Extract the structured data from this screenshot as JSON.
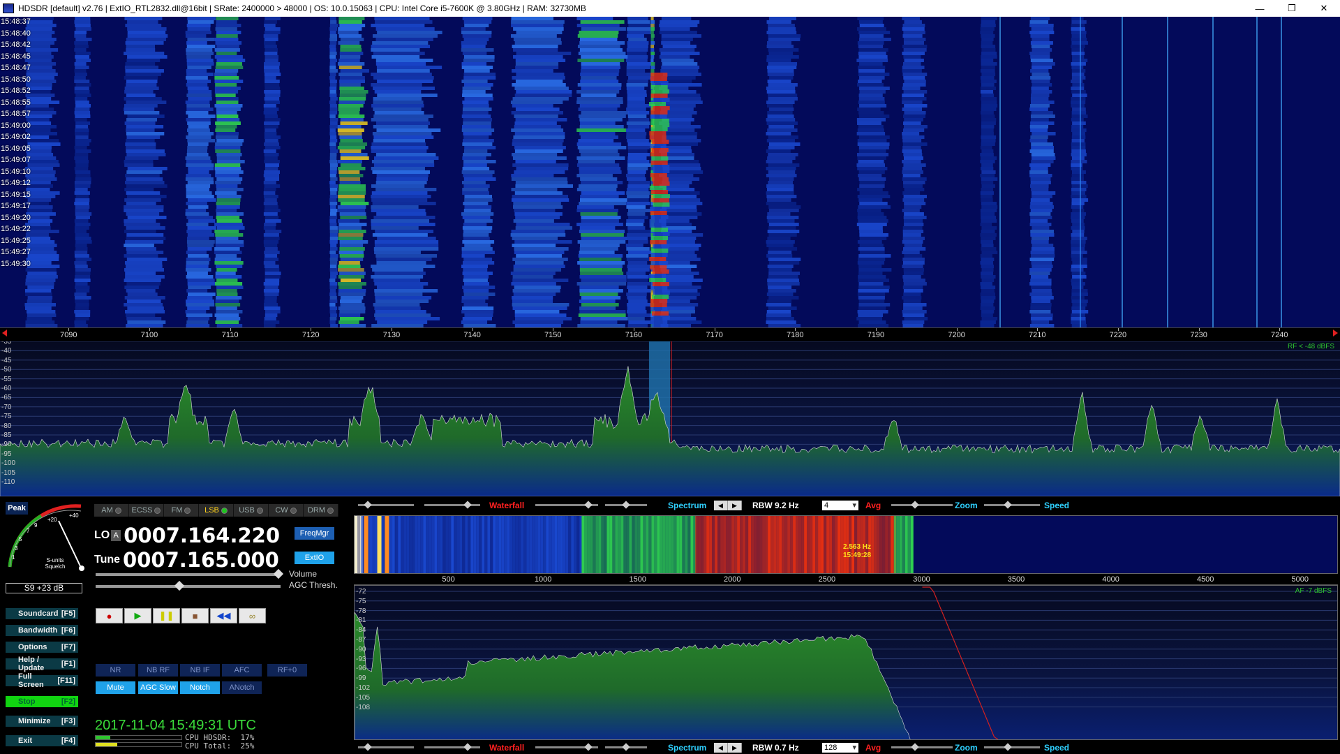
{
  "window": {
    "title": "HDSDR  [default]  v2.76   |  ExtIO_RTL2832.dll@16bit  |  SRate: 2400000 > 48000  |  OS: 10.0.15063   |  CPU: Intel Core i5-7600K @ 3.80GHz  |  RAM: 32730MB",
    "minimize_glyph": "—",
    "restore_glyph": "❐",
    "close_glyph": "✕"
  },
  "waterfall": {
    "times": [
      "15:48:37",
      "15:48:40",
      "15:48:42",
      "15:48:45",
      "15:48:47",
      "15:48:50",
      "15:48:52",
      "15:48:55",
      "15:48:57",
      "15:49:00",
      "15:49:02",
      "15:49:05",
      "15:49:07",
      "15:49:10",
      "15:49:12",
      "15:49:15",
      "15:49:17",
      "15:49:20",
      "15:49:22",
      "15:49:25",
      "15:49:27",
      "15:49:30"
    ]
  },
  "freq_scale": {
    "labels": [
      "7090",
      "7100",
      "7110",
      "7120",
      "7130",
      "7140",
      "7150",
      "7160",
      "7170",
      "7180",
      "7190",
      "7200",
      "7210",
      "7220",
      "7230",
      "7240"
    ],
    "range_khz": [
      7081.5,
      7247.5
    ]
  },
  "spectrum_rf": {
    "db_labels": [
      "-35",
      "-40",
      "-45",
      "-50",
      "-55",
      "-60",
      "-65",
      "-70",
      "-75",
      "-80",
      "-85",
      "-90",
      "-95",
      "-100",
      "-105",
      "-110"
    ],
    "rf_indicator": "RF < -48 dBFS",
    "filter_range_khz": [
      7161.9,
      7164.5
    ]
  },
  "smeter": {
    "peak_label": "Peak",
    "scale_labels": [
      "1",
      "3",
      "5",
      "7",
      "9",
      "+20",
      "+40"
    ],
    "caption1": "S-units",
    "caption2": "Squelch",
    "value": "S9 +23 dB"
  },
  "modes": [
    {
      "label": "AM",
      "active": false
    },
    {
      "label": "ECSS",
      "active": false
    },
    {
      "label": "FM",
      "active": false
    },
    {
      "label": "LSB",
      "active": true
    },
    {
      "label": "USB",
      "active": false
    },
    {
      "label": "CW",
      "active": false
    },
    {
      "label": "DRM",
      "active": false
    }
  ],
  "lo": {
    "label": "LO",
    "a": "A",
    "value": "0007.164.220"
  },
  "tune": {
    "label": "Tune",
    "value": "0007.165.000"
  },
  "buttons": {
    "freqmgr": "FreqMgr",
    "extio": "ExtIO",
    "volume_label": "Volume",
    "agc_label": "AGC Thresh."
  },
  "transport": {
    "record": "●",
    "play": "▶",
    "pause": "❚❚",
    "stop": "■",
    "rewind": "◀◀",
    "loop": "∞"
  },
  "side_buttons": [
    {
      "label": "Soundcard",
      "key": "[F5]"
    },
    {
      "label": "Bandwidth",
      "key": "[F6]"
    },
    {
      "label": "Options",
      "key": "[F7]"
    },
    {
      "label": "Help / Update",
      "key": "[F1]"
    },
    {
      "label": "Full Screen",
      "key": "[F11]"
    },
    {
      "label": "Stop",
      "key": "[F2]"
    },
    {
      "label": "Minimize",
      "key": "[F3]"
    },
    {
      "label": "Exit",
      "key": "[F4]"
    }
  ],
  "dsp_row1": [
    "NR",
    "NB RF",
    "NB IF",
    "AFC",
    "RF+0"
  ],
  "dsp_row2": [
    {
      "label": "Mute",
      "on": true
    },
    {
      "label": "AGC Slow",
      "on": true
    },
    {
      "label": "Notch",
      "on": true
    },
    {
      "label": "ANotch",
      "on": false
    }
  ],
  "status": {
    "datetime": "2017-11-04   15:49:31 UTC",
    "cpu_hdsdr": "CPU HDSDR:  17%",
    "cpu_total": "CPU Total:  25%",
    "cpu_hdsdr_pct": 17,
    "cpu_total_pct": 25
  },
  "ctrl_top": {
    "waterfall": "Waterfall",
    "spectrum": "Spectrum",
    "rbw": "RBW  9.2 Hz",
    "avg_value": "4",
    "avg": "Avg",
    "zoom": "Zoom",
    "speed": "Speed"
  },
  "ctrl_bottom": {
    "waterfall": "Waterfall",
    "spectrum": "Spectrum",
    "rbw": "RBW  0.7 Hz",
    "avg_value": "128",
    "avg": "Avg",
    "zoom": "Zoom",
    "speed": "Speed"
  },
  "af_scale": {
    "labels": [
      "500",
      "1000",
      "1500",
      "2000",
      "2500",
      "3000",
      "3500",
      "4000",
      "4500",
      "5000"
    ],
    "range_hz": [
      0,
      5200
    ]
  },
  "af_spectrum": {
    "db_labels": [
      "-72",
      "-75",
      "-78",
      "-81",
      "-84",
      "-87",
      "-90",
      "-93",
      "-96",
      "-99",
      "-102",
      "-105",
      "-108"
    ],
    "af_indicator": "AF  -7 dBFS"
  },
  "af_cursor": {
    "freq": "2.563 Hz",
    "time": "15:49:28"
  },
  "colors": {
    "accent_blue": "#1fa2ea",
    "green": "#11d411",
    "lsb_active": "#ffd21a",
    "waterfall_label": "#ff2020",
    "spectrum_label": "#2fd0ff",
    "speed_label": "#2fd0ff"
  }
}
